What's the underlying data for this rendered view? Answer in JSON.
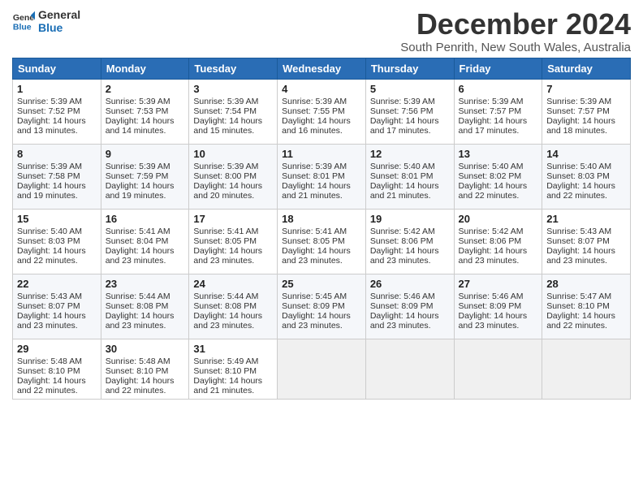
{
  "logo": {
    "line1": "General",
    "line2": "Blue"
  },
  "title": "December 2024",
  "subtitle": "South Penrith, New South Wales, Australia",
  "headers": [
    "Sunday",
    "Monday",
    "Tuesday",
    "Wednesday",
    "Thursday",
    "Friday",
    "Saturday"
  ],
  "weeks": [
    [
      {
        "day": "1",
        "sunrise": "5:39 AM",
        "sunset": "7:52 PM",
        "daylight": "14 hours and 13 minutes."
      },
      {
        "day": "2",
        "sunrise": "5:39 AM",
        "sunset": "7:53 PM",
        "daylight": "14 hours and 14 minutes."
      },
      {
        "day": "3",
        "sunrise": "5:39 AM",
        "sunset": "7:54 PM",
        "daylight": "14 hours and 15 minutes."
      },
      {
        "day": "4",
        "sunrise": "5:39 AM",
        "sunset": "7:55 PM",
        "daylight": "14 hours and 16 minutes."
      },
      {
        "day": "5",
        "sunrise": "5:39 AM",
        "sunset": "7:56 PM",
        "daylight": "14 hours and 17 minutes."
      },
      {
        "day": "6",
        "sunrise": "5:39 AM",
        "sunset": "7:57 PM",
        "daylight": "14 hours and 17 minutes."
      },
      {
        "day": "7",
        "sunrise": "5:39 AM",
        "sunset": "7:57 PM",
        "daylight": "14 hours and 18 minutes."
      }
    ],
    [
      {
        "day": "8",
        "sunrise": "5:39 AM",
        "sunset": "7:58 PM",
        "daylight": "14 hours and 19 minutes."
      },
      {
        "day": "9",
        "sunrise": "5:39 AM",
        "sunset": "7:59 PM",
        "daylight": "14 hours and 19 minutes."
      },
      {
        "day": "10",
        "sunrise": "5:39 AM",
        "sunset": "8:00 PM",
        "daylight": "14 hours and 20 minutes."
      },
      {
        "day": "11",
        "sunrise": "5:39 AM",
        "sunset": "8:01 PM",
        "daylight": "14 hours and 21 minutes."
      },
      {
        "day": "12",
        "sunrise": "5:40 AM",
        "sunset": "8:01 PM",
        "daylight": "14 hours and 21 minutes."
      },
      {
        "day": "13",
        "sunrise": "5:40 AM",
        "sunset": "8:02 PM",
        "daylight": "14 hours and 22 minutes."
      },
      {
        "day": "14",
        "sunrise": "5:40 AM",
        "sunset": "8:03 PM",
        "daylight": "14 hours and 22 minutes."
      }
    ],
    [
      {
        "day": "15",
        "sunrise": "5:40 AM",
        "sunset": "8:03 PM",
        "daylight": "14 hours and 22 minutes."
      },
      {
        "day": "16",
        "sunrise": "5:41 AM",
        "sunset": "8:04 PM",
        "daylight": "14 hours and 23 minutes."
      },
      {
        "day": "17",
        "sunrise": "5:41 AM",
        "sunset": "8:05 PM",
        "daylight": "14 hours and 23 minutes."
      },
      {
        "day": "18",
        "sunrise": "5:41 AM",
        "sunset": "8:05 PM",
        "daylight": "14 hours and 23 minutes."
      },
      {
        "day": "19",
        "sunrise": "5:42 AM",
        "sunset": "8:06 PM",
        "daylight": "14 hours and 23 minutes."
      },
      {
        "day": "20",
        "sunrise": "5:42 AM",
        "sunset": "8:06 PM",
        "daylight": "14 hours and 23 minutes."
      },
      {
        "day": "21",
        "sunrise": "5:43 AM",
        "sunset": "8:07 PM",
        "daylight": "14 hours and 23 minutes."
      }
    ],
    [
      {
        "day": "22",
        "sunrise": "5:43 AM",
        "sunset": "8:07 PM",
        "daylight": "14 hours and 23 minutes."
      },
      {
        "day": "23",
        "sunrise": "5:44 AM",
        "sunset": "8:08 PM",
        "daylight": "14 hours and 23 minutes."
      },
      {
        "day": "24",
        "sunrise": "5:44 AM",
        "sunset": "8:08 PM",
        "daylight": "14 hours and 23 minutes."
      },
      {
        "day": "25",
        "sunrise": "5:45 AM",
        "sunset": "8:09 PM",
        "daylight": "14 hours and 23 minutes."
      },
      {
        "day": "26",
        "sunrise": "5:46 AM",
        "sunset": "8:09 PM",
        "daylight": "14 hours and 23 minutes."
      },
      {
        "day": "27",
        "sunrise": "5:46 AM",
        "sunset": "8:09 PM",
        "daylight": "14 hours and 23 minutes."
      },
      {
        "day": "28",
        "sunrise": "5:47 AM",
        "sunset": "8:10 PM",
        "daylight": "14 hours and 22 minutes."
      }
    ],
    [
      {
        "day": "29",
        "sunrise": "5:48 AM",
        "sunset": "8:10 PM",
        "daylight": "14 hours and 22 minutes."
      },
      {
        "day": "30",
        "sunrise": "5:48 AM",
        "sunset": "8:10 PM",
        "daylight": "14 hours and 22 minutes."
      },
      {
        "day": "31",
        "sunrise": "5:49 AM",
        "sunset": "8:10 PM",
        "daylight": "14 hours and 21 minutes."
      },
      null,
      null,
      null,
      null
    ]
  ],
  "labels": {
    "sunrise": "Sunrise: ",
    "sunset": "Sunset: ",
    "daylight": "Daylight: "
  }
}
